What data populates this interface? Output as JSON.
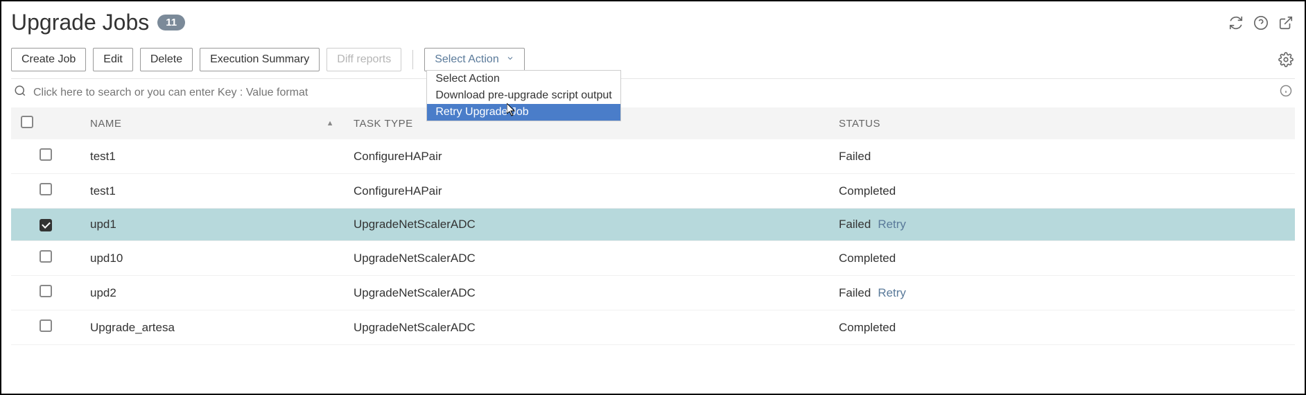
{
  "header": {
    "title": "Upgrade Jobs",
    "count": "11"
  },
  "toolbar": {
    "create": "Create Job",
    "edit": "Edit",
    "delete": "Delete",
    "exec": "Execution Summary",
    "diff": "Diff reports",
    "select_action": "Select Action"
  },
  "dropdown": {
    "items": [
      "Select Action",
      "Download pre-upgrade script output",
      "Retry Upgrade Job"
    ],
    "highlighted_index": 2
  },
  "search": {
    "placeholder": "Click here to search or you can enter Key : Value format"
  },
  "columns": {
    "name": "NAME",
    "task": "TASK TYPE",
    "status": "STATUS"
  },
  "rows": [
    {
      "checked": false,
      "name": "test1",
      "task": "ConfigureHAPair",
      "status": "Failed",
      "retry": false,
      "selected": false
    },
    {
      "checked": false,
      "name": "test1",
      "task": "ConfigureHAPair",
      "status": "Completed",
      "retry": false,
      "selected": false
    },
    {
      "checked": true,
      "name": "upd1",
      "task": "UpgradeNetScalerADC",
      "status": "Failed",
      "retry": true,
      "selected": true
    },
    {
      "checked": false,
      "name": "upd10",
      "task": "UpgradeNetScalerADC",
      "status": "Completed",
      "retry": false,
      "selected": false
    },
    {
      "checked": false,
      "name": "upd2",
      "task": "UpgradeNetScalerADC",
      "status": "Failed",
      "retry": true,
      "selected": false
    },
    {
      "checked": false,
      "name": "Upgrade_artesa",
      "task": "UpgradeNetScalerADC",
      "status": "Completed",
      "retry": false,
      "selected": false
    }
  ],
  "retry_label": "Retry"
}
